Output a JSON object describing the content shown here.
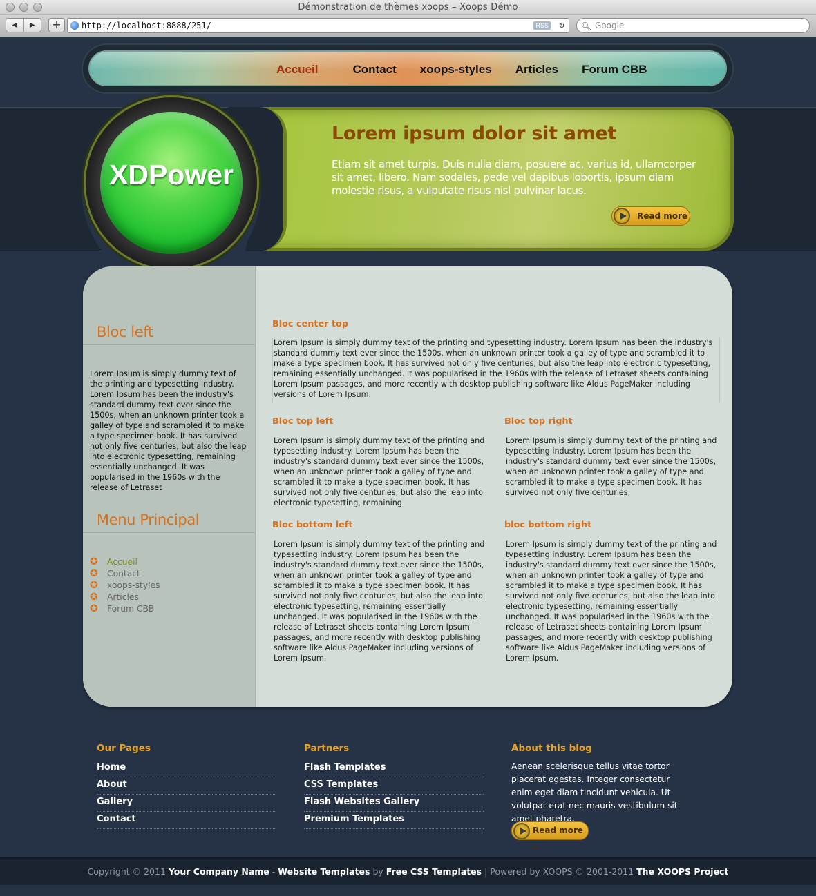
{
  "window": {
    "title": "Démonstration de thèmes xoops – Xoops Démo"
  },
  "toolbar": {
    "back": "◀",
    "forward": "▶",
    "add": "+",
    "url": "http://localhost:8888/251/",
    "rss": "RSS",
    "reload": "↻",
    "search_placeholder": "Google"
  },
  "nav": {
    "items": [
      "Accueil",
      "Contact",
      "xoops-styles",
      "Articles",
      "Forum CBB"
    ],
    "active": "Accueil"
  },
  "logo": {
    "text": "XDPower"
  },
  "banner": {
    "title": "Lorem ipsum dolor sit amet",
    "text": "Etiam sit amet turpis. Duis nulla diam, posuere ac, varius id, ullamcorper sit amet, libero. Nam sodales, pede vel dapibus lobortis, ipsum diam molestie risus, a vulputate risus nisl pulvinar lacus.",
    "read_more": "Read more"
  },
  "left": {
    "bloc_left_title": "Bloc left",
    "bloc_left_text": "Lorem Ipsum is simply dummy text of the printing and typesetting industry. Lorem Ipsum has been the industry's standard dummy text ever since the 1500s, when an unknown printer took a galley of type and scrambled it to make a type specimen book. It has survived not only five centuries, but also the leap into electronic typesetting, remaining essentially unchanged. It was popularised in the 1960s with the release of Letraset",
    "menu_title": "Menu Principal",
    "menu": [
      "Accueil",
      "Contact",
      "xoops-styles",
      "Articles",
      "Forum CBB"
    ]
  },
  "center": {
    "top_title": "Bloc center top",
    "top_text": "Lorem Ipsum is simply dummy text of the printing and typesetting industry. Lorem Ipsum has been the industry's standard dummy text ever since the 1500s, when an unknown printer took a galley of type and scrambled it to make a type specimen book. It has survived not only five centuries, but also the leap into electronic typesetting, remaining essentially unchanged. It was popularised in the 1960s with the release of Letraset sheets containing Lorem Ipsum passages, and more recently with desktop publishing software like Aldus PageMaker including versions of Lorem Ipsum.",
    "top_left_title": "Bloc top left",
    "top_left_text": "Lorem Ipsum is simply dummy text of the printing and typesetting industry. Lorem Ipsum has been the industry's standard dummy text ever since the 1500s, when an unknown printer took a galley of type and scrambled it to make a type specimen book. It has survived not only five centuries, but also the leap into electronic typesetting, remaining",
    "top_right_title": "Bloc top right",
    "top_right_text": "Lorem Ipsum is simply dummy text of the printing and typesetting industry. Lorem Ipsum has been the industry's standard dummy text ever since the 1500s, when an unknown printer took a galley of type and scrambled it to make a type specimen book. It has survived not only five centuries,",
    "bottom_left_title": "Bloc bottom left",
    "bottom_left_text": "Lorem Ipsum is simply dummy text of the printing and typesetting industry. Lorem Ipsum has been the industry's standard dummy text ever since the 1500s, when an unknown printer took a galley of type and scrambled it to make a type specimen book. It has survived not only five centuries, but also the leap into electronic typesetting, remaining essentially unchanged. It was popularised in the 1960s with the release of Letraset sheets containing Lorem Ipsum passages, and more recently with desktop publishing software like Aldus PageMaker including versions of Lorem Ipsum.",
    "bottom_right_title": "bloc bottom right",
    "bottom_right_text": "Lorem Ipsum is simply dummy text of the printing and typesetting industry. Lorem Ipsum has been the industry's standard dummy text ever since the 1500s, when an unknown printer took a galley of type and scrambled it to make a type specimen book. It has survived not only five centuries, but also the leap into electronic typesetting, remaining essentially unchanged. It was popularised in the 1960s with the release of Letraset sheets containing Lorem Ipsum passages, and more recently with desktop publishing software like Aldus PageMaker including versions of Lorem Ipsum."
  },
  "footer": {
    "pages_title": "Our Pages",
    "pages": [
      "Home",
      "About",
      "Gallery",
      "Contact"
    ],
    "partners_title": "Partners",
    "partners": [
      "Flash Templates",
      "CSS Templates",
      "Flash Websites Gallery",
      "Premium Templates"
    ],
    "about_title": "About this blog",
    "about_text": "Aenean scelerisque tellus vitae tortor placerat egestas. Integer consectetur enim eget diam tincidunt vehicula. Ut volutpat erat nec mauris vestibulum sit amet pharetra.",
    "read_more": "Read more »"
  },
  "copyright": {
    "prefix": "Copyright © 2011",
    "company": "Your Company Name",
    "dash": " - ",
    "website_templates": "Website Templates",
    "by": " by ",
    "free_css": "Free CSS Templates",
    "powered": " | Powered by XOOPS © 2001-2011 ",
    "xoops_project": "The XOOPS Project"
  }
}
